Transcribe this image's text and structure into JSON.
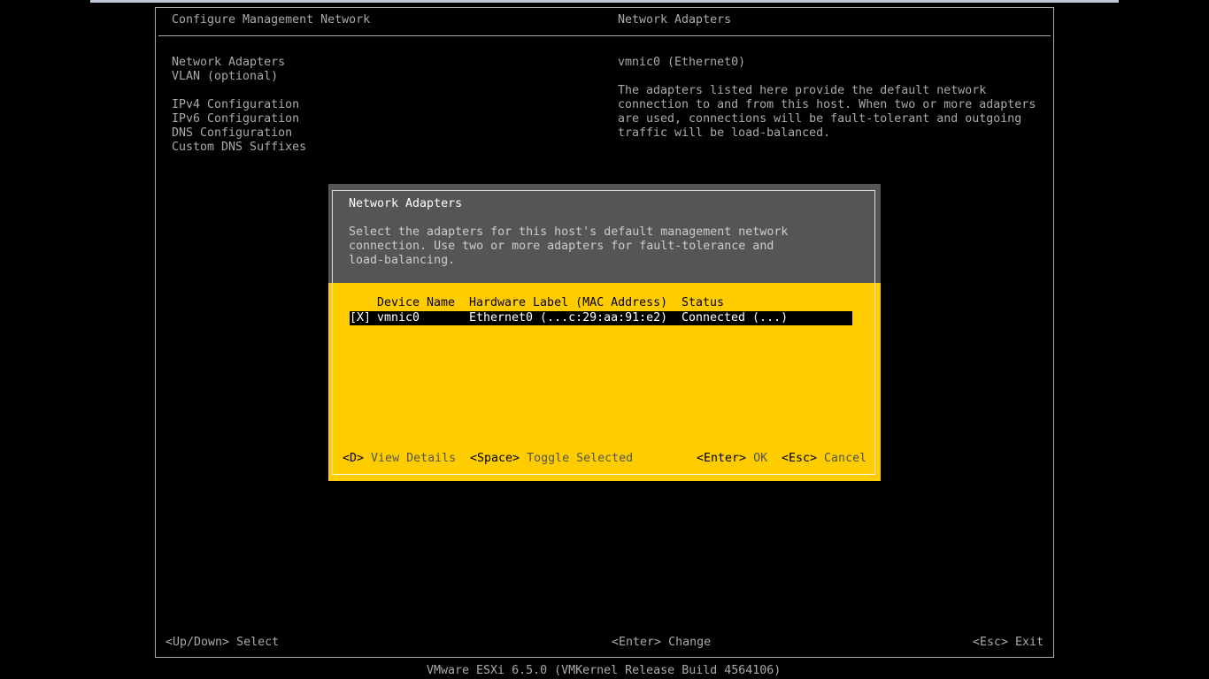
{
  "window": {
    "title": "Configure Management Network",
    "right_title": "Network Adapters"
  },
  "menu": {
    "items": [
      "Network Adapters",
      "VLAN (optional)",
      "IPv4 Configuration",
      "IPv6 Configuration",
      "DNS Configuration",
      "Custom DNS Suffixes"
    ]
  },
  "info": {
    "adapter": "vmnic0 (Ethernet0)",
    "description": [
      "The adapters listed here provide the default network",
      "connection to and from this host. When two or more adapters",
      "are used, connections will be fault-tolerant and outgoing",
      "traffic will be load-balanced."
    ]
  },
  "dialog": {
    "title": "Network Adapters",
    "description": [
      "Select the adapters for this host's default management network",
      "connection. Use two or more adapters for fault-tolerance and",
      "load-balancing."
    ],
    "columns": {
      "device": "Device Name",
      "hardware": "Hardware Label (MAC Address)",
      "status": "Status"
    },
    "rows": [
      {
        "checkbox": "[X]",
        "device": "vmnic0",
        "hardware": "Ethernet0 (...c:29:aa:91:e2)",
        "status": "Connected (...)"
      }
    ],
    "actions": {
      "details_key": "<D>",
      "details_label": "View Details",
      "toggle_key": "<Space>",
      "toggle_label": "Toggle Selected",
      "ok_key": "<Enter>",
      "ok_label": "OK",
      "cancel_key": "<Esc>",
      "cancel_label": "Cancel"
    }
  },
  "footer": {
    "select_key": "<Up/Down>",
    "select_label": "Select",
    "change_key": "<Enter>",
    "change_label": "Change",
    "exit_key": "<Esc>",
    "exit_label": "Exit"
  },
  "status_bar": {
    "text": "VMware ESXi 6.5.0 (VMKernel Release Build 4564106)"
  },
  "colors": {
    "background": "#000000",
    "text": "#aaaaaa",
    "dialog_header": "#555555",
    "dialog_body": "#ffcc00",
    "highlight": "#ffffff"
  }
}
